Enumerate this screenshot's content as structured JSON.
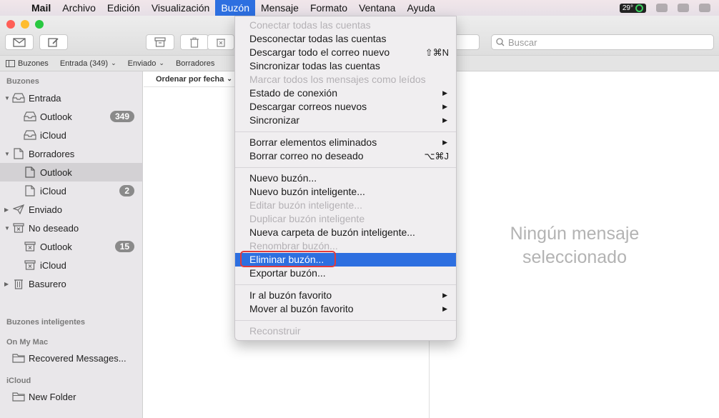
{
  "menubar": {
    "app": "Mail",
    "items": [
      "Archivo",
      "Edición",
      "Visualización",
      "Buzón",
      "Mensaje",
      "Formato",
      "Ventana",
      "Ayuda"
    ],
    "active": "Buzón",
    "temperature": "29°"
  },
  "toolbar": {
    "search_placeholder": "Buscar"
  },
  "favorites": {
    "mailboxes": "Buzones",
    "inbox": "Entrada (349)",
    "sent": "Enviado",
    "drafts": "Borradores"
  },
  "sidebar": {
    "section_mailboxes": "Buzones",
    "section_smart": "Buzones inteligentes",
    "section_mac": "On My Mac",
    "section_icloud": "iCloud",
    "inbox": {
      "label": "Entrada",
      "children": [
        {
          "label": "Outlook",
          "badge": "349"
        },
        {
          "label": "iCloud"
        }
      ]
    },
    "drafts": {
      "label": "Borradores",
      "children": [
        {
          "label": "Outlook"
        },
        {
          "label": "iCloud",
          "badge": "2"
        }
      ]
    },
    "sent": {
      "label": "Enviado"
    },
    "junk": {
      "label": "No deseado",
      "children": [
        {
          "label": "Outlook",
          "badge": "15"
        },
        {
          "label": "iCloud"
        }
      ]
    },
    "trash": {
      "label": "Basurero"
    },
    "mac_folder": "Recovered Messages...",
    "icloud_folder": "New Folder"
  },
  "list": {
    "sort_label": "Ordenar por fecha"
  },
  "viewer": {
    "empty_line1": "Ningún mensaje",
    "empty_line2": "seleccionado"
  },
  "menu": {
    "items": [
      {
        "label": "Conectar todas las cuentas",
        "disabled": true
      },
      {
        "label": "Desconectar todas las cuentas"
      },
      {
        "label": "Descargar todo el correo nuevo",
        "shortcut": "⇧⌘N"
      },
      {
        "label": "Sincronizar todas las cuentas"
      },
      {
        "label": "Marcar todos los mensajes como leídos",
        "disabled": true
      },
      {
        "label": "Estado de conexión",
        "submenu": true
      },
      {
        "label": "Descargar correos nuevos",
        "submenu": true
      },
      {
        "label": "Sincronizar",
        "submenu": true
      },
      {
        "label": "Borrar elementos eliminados",
        "submenu": true
      },
      {
        "label": "Borrar correo no deseado",
        "shortcut": "⌥⌘J"
      },
      {
        "label": "Nuevo buzón..."
      },
      {
        "label": "Nuevo buzón inteligente..."
      },
      {
        "label": "Editar buzón inteligente...",
        "disabled": true
      },
      {
        "label": "Duplicar buzón inteligente",
        "disabled": true
      },
      {
        "label": "Nueva carpeta de buzón inteligente..."
      },
      {
        "label": "Renombrar buzón...",
        "disabled": true
      },
      {
        "label": "Eliminar buzón...",
        "highlighted": true
      },
      {
        "label": "Exportar buzón..."
      },
      {
        "label": "Ir al buzón favorito",
        "submenu": true
      },
      {
        "label": "Mover al buzón favorito",
        "submenu": true
      },
      {
        "label": "Reconstruir",
        "disabled": true
      }
    ]
  }
}
